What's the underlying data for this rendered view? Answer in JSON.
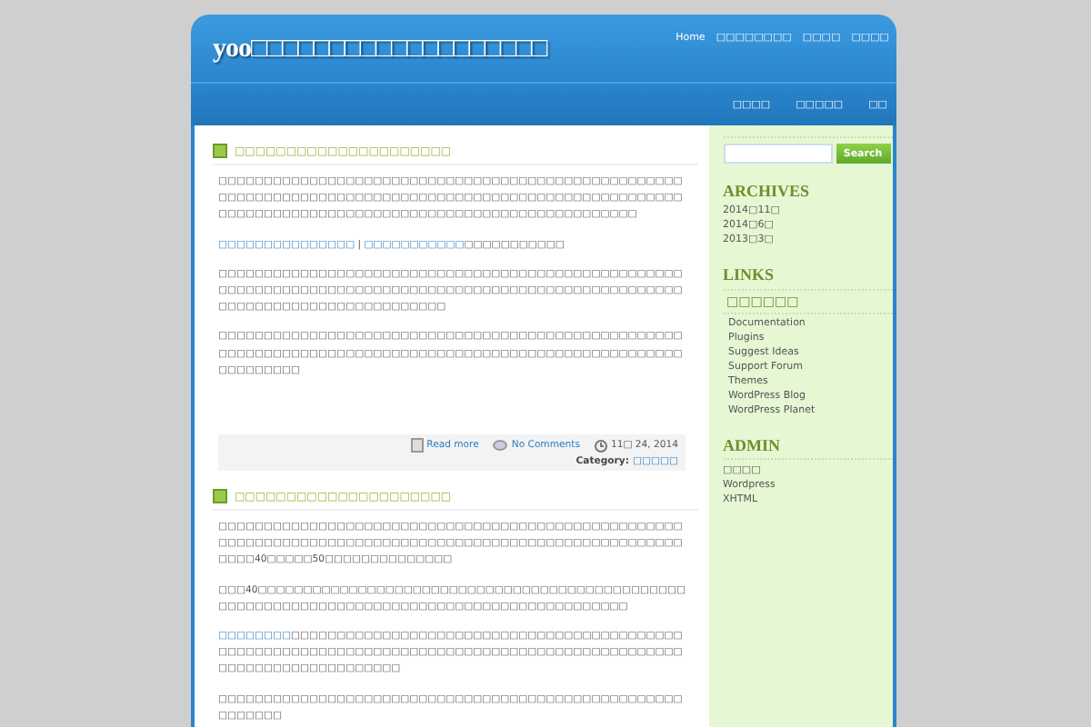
{
  "header": {
    "site_title": "yoo□□□□□□□□□□□□□□□□□□□",
    "top_nav": [
      {
        "label": "Home"
      },
      {
        "label": "□□□□□□□□"
      },
      {
        "label": "□□□□"
      },
      {
        "label": "□□□□"
      }
    ],
    "sub_nav": [
      {
        "label": "□□□□"
      },
      {
        "label": "□□□□□"
      },
      {
        "label": "□□"
      }
    ]
  },
  "posts": [
    {
      "title": "□□□□□□□□□□□□□□□□□□□□□",
      "paragraphs": [
        {
          "kind": "text",
          "text": "□□□□□□□□□□□□□□□□□□□□□□□□□□□□□□□□□□□□□□□□□□□□□□□□□□□□□□□□□□□□□□□□□□□□□□□□□□□□□□□□□□□□□□□□□□□□□□□□□□□□□□□□□□□□□□□□□□□□□□□□□□□□□□□□□□□□□□□□□□□□□□□□□□□□"
        },
        {
          "kind": "links",
          "link_1": "□□□□□□□□□□□□□□□",
          "separator": " | ",
          "link_2": "□□□□□□□□□□□",
          "text": "□□□□□□□□□□□"
        },
        {
          "kind": "text",
          "text": "□□□□□□□□□□□□□□□□□□□□□□□□□□□□□□□□□□□□□□□□□□□□□□□□□□□□□□□□□□□□□□□□□□□□□□□□□□□□□□□□□□□□□□□□□□□□□□□□□□□□□□□□□□□□□□□□□□□□□□□□□□□□□□□"
        },
        {
          "kind": "text",
          "text": "□□□□□□□□□□□□□□□□□□□□□□□□□□□□□□□□□□□□□□□□□□□□□□□□□□□□□□□□□□□□□□□□□□□□□□□□□□□□□□□□□□□□□□□□□□□□□□□□□□□□□□□□□□□□□□□"
        }
      ],
      "meta": {
        "read_more": "Read more",
        "comments": "No Comments",
        "date": "11□ 24, 2014",
        "category_label": "Category:",
        "category": "□□□□□"
      }
    },
    {
      "title": "□□□□□□□□□□□□□□□□□□□□□",
      "paragraphs": [
        {
          "kind": "text",
          "text": "□□□□□□□□□□□□□□□□□□□□□□□□□□□□□□□□□□□□□□□□□□□□□□□□□□□□□□□□□□□□□□□□□□□□□□□□□□□□□□□□□□□□□□□□□□□□□□□□□□□□□□□□□□40□□□□□50□□□□□□□□□□□□□□"
        },
        {
          "kind": "text",
          "text": "□□□40□□□□□□□□□□□□□□□□□□□□□□□□□□□□□□□□□□□□□□□□□□□□□□□□□□□□□□□□□□□□□□□□□□□□□□□□□□□□□□□□□□□□□□□□□□□□"
        },
        {
          "kind": "lead_link",
          "link_1": "□□□□□□□□",
          "text": "□□□□□□□□□□□□□□□□□□□□□□□□□□□□□□□□□□□□□□□□□□□□□□□□□□□□□□□□□□□□□□□□□□□□□□□□□□□□□□□□□□□□□□□□□□□□□□□□□□□□□□□□□□□□□□□□□□"
        },
        {
          "kind": "text",
          "text": "□□□□□□□□□□□□□□□□□□□□□□□□□□□□□□□□□□□□□□□□□□□□□□□□□□□□□□□□□□"
        }
      ]
    }
  ],
  "sidebar": {
    "search": {
      "button": "Search"
    },
    "archives": {
      "heading": "ARCHIVES",
      "items": [
        "2014□11□",
        "2014□6□",
        "2013□3□"
      ]
    },
    "links": {
      "heading": "LINKS",
      "subheading": "□□□□□□",
      "items": [
        "Documentation",
        "Plugins",
        "Suggest Ideas",
        "Support Forum",
        "Themes",
        "WordPress Blog",
        "WordPress Planet"
      ]
    },
    "admin": {
      "heading": "ADMIN",
      "items": [
        "□□□□",
        "Wordpress",
        "XHTML"
      ]
    }
  }
}
